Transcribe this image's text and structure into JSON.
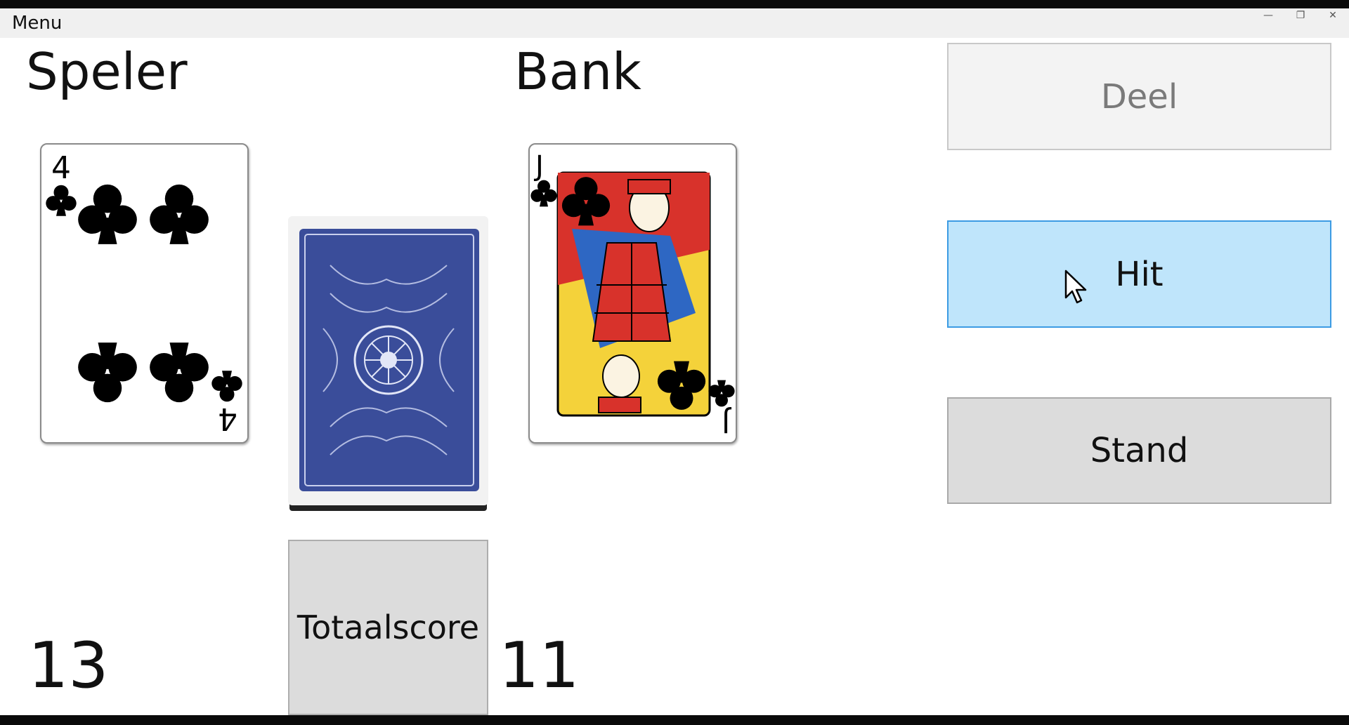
{
  "menubar": {
    "menu_label": "Menu"
  },
  "player": {
    "title": "Speler",
    "score": "13",
    "card": {
      "rank": "4",
      "suit": "clubs"
    }
  },
  "bank": {
    "title": "Bank",
    "score": "11",
    "card": {
      "rank": "J",
      "suit": "clubs"
    }
  },
  "deck": {
    "state": "face-down"
  },
  "buttons": {
    "deal": "Deel",
    "hit": "Hit",
    "stand": "Stand",
    "total": "Totaalscore"
  },
  "colors": {
    "hit_bg": "#bfe5fb",
    "hit_border": "#3c9be3",
    "card_back": "#3a4d9a"
  }
}
